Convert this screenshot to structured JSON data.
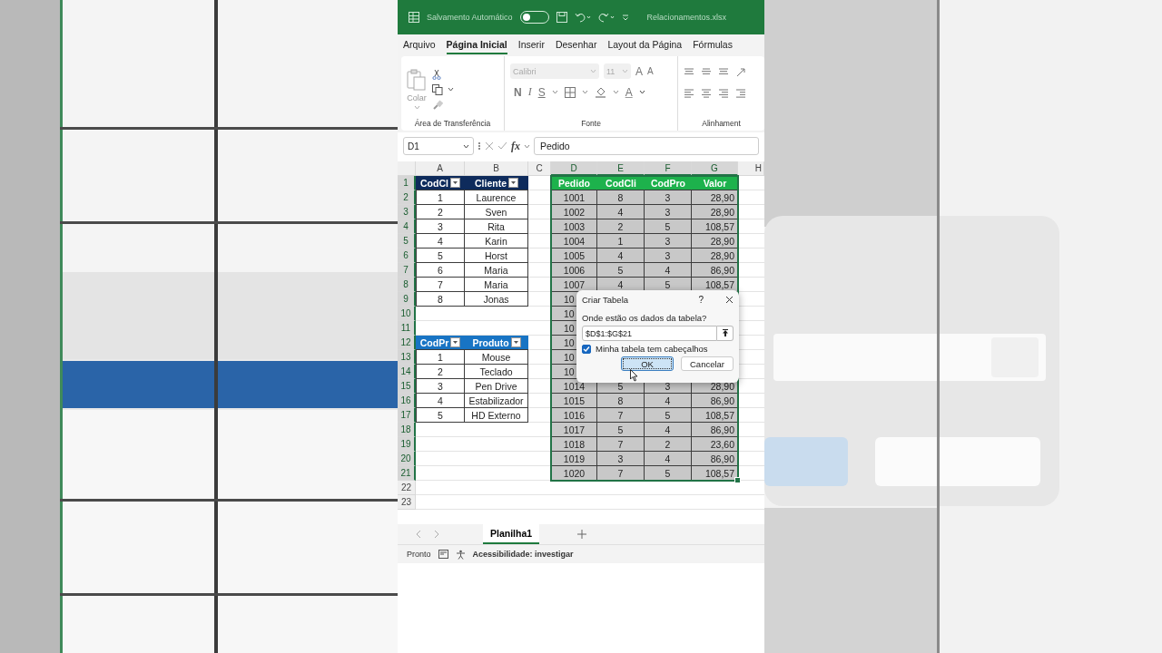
{
  "title_bar": {
    "autosave_label": "Salvamento Automático",
    "autosave_on": false,
    "file_name": "Relacionamentos.xlsx"
  },
  "ribbon_tabs": [
    {
      "label": "Arquivo",
      "selected": false
    },
    {
      "label": "Página Inicial",
      "selected": true
    },
    {
      "label": "Inserir",
      "selected": false
    },
    {
      "label": "Desenhar",
      "selected": false
    },
    {
      "label": "Layout da Página",
      "selected": false
    },
    {
      "label": "Fórmulas",
      "selected": false
    }
  ],
  "ribbon": {
    "paste_label": "Colar",
    "font_name": "Calibri",
    "font_size": "11",
    "font_size_buttons": [
      "A",
      "A"
    ],
    "style_buttons": [
      "N",
      "I",
      "S"
    ],
    "font_color_button": "A",
    "groups": [
      "Área de Transferência",
      "Fonte",
      "Alinhament"
    ]
  },
  "formula_bar": {
    "name_box": "D1",
    "function_label": "fx",
    "formula": "Pedido"
  },
  "grid": {
    "columns": [
      {
        "label": "A",
        "selected": false
      },
      {
        "label": "B",
        "selected": false
      },
      {
        "label": "C",
        "selected": false
      },
      {
        "label": "D",
        "selected": true
      },
      {
        "label": "E",
        "selected": true
      },
      {
        "label": "F",
        "selected": true
      },
      {
        "label": "G",
        "selected": true
      },
      {
        "label": "H",
        "selected": false
      }
    ],
    "row_headers": [
      {
        "label": "1",
        "selected": true
      },
      {
        "label": "2",
        "selected": true
      },
      {
        "label": "3",
        "selected": true
      },
      {
        "label": "4",
        "selected": true
      },
      {
        "label": "5",
        "selected": true
      },
      {
        "label": "6",
        "selected": true
      },
      {
        "label": "7",
        "selected": true
      },
      {
        "label": "8",
        "selected": true
      },
      {
        "label": "9",
        "selected": true
      },
      {
        "label": "10",
        "selected": true
      },
      {
        "label": "11",
        "selected": true
      },
      {
        "label": "12",
        "selected": true
      },
      {
        "label": "13",
        "selected": true
      },
      {
        "label": "14",
        "selected": true
      },
      {
        "label": "15",
        "selected": true
      },
      {
        "label": "16",
        "selected": true
      },
      {
        "label": "17",
        "selected": true
      },
      {
        "label": "18",
        "selected": true
      },
      {
        "label": "19",
        "selected": true
      },
      {
        "label": "20",
        "selected": true
      },
      {
        "label": "21",
        "selected": true
      },
      {
        "label": "22",
        "selected": false
      },
      {
        "label": "23",
        "selected": false
      }
    ]
  },
  "tables": [
    {
      "color": "#0e2b5c",
      "filter_buttons": true,
      "selected": false,
      "columns": [
        {
          "label": "CodCl"
        },
        {
          "label": "Cliente"
        }
      ],
      "rows": [
        {
          "cells": [
            "1",
            "Laurence"
          ]
        },
        {
          "cells": [
            "2",
            "Sven"
          ]
        },
        {
          "cells": [
            "3",
            "Rita"
          ]
        },
        {
          "cells": [
            "4",
            "Karin"
          ]
        },
        {
          "cells": [
            "5",
            "Horst"
          ]
        },
        {
          "cells": [
            "6",
            "Maria"
          ]
        },
        {
          "cells": [
            "7",
            "Maria"
          ]
        },
        {
          "cells": [
            "8",
            "Jonas"
          ]
        }
      ]
    },
    {
      "color": "#1874c4",
      "filter_buttons": true,
      "selected": false,
      "columns": [
        {
          "label": "CodPr"
        },
        {
          "label": "Produto"
        }
      ],
      "rows": [
        {
          "cells": [
            "1",
            "Mouse"
          ]
        },
        {
          "cells": [
            "2",
            "Teclado"
          ]
        },
        {
          "cells": [
            "3",
            "Pen Drive"
          ]
        },
        {
          "cells": [
            "4",
            "Estabilizador"
          ]
        },
        {
          "cells": [
            "5",
            "HD Externo"
          ]
        }
      ]
    },
    {
      "color": "#1db24c",
      "filter_buttons": false,
      "selected": true,
      "columns": [
        {
          "label": "Pedido"
        },
        {
          "label": "CodCli"
        },
        {
          "label": "CodPro"
        },
        {
          "label": "Valor"
        }
      ],
      "rows": [
        {
          "cells": [
            "1001",
            "8",
            "3",
            "28,90"
          ],
          "covered": false
        },
        {
          "cells": [
            "1002",
            "4",
            "3",
            "28,90"
          ],
          "covered": false
        },
        {
          "cells": [
            "1003",
            "2",
            "5",
            "108,57"
          ],
          "covered": false
        },
        {
          "cells": [
            "1004",
            "1",
            "3",
            "28,90"
          ],
          "covered": false
        },
        {
          "cells": [
            "1005",
            "4",
            "3",
            "28,90"
          ],
          "covered": false
        },
        {
          "cells": [
            "1006",
            "5",
            "4",
            "86,90"
          ],
          "covered": false
        },
        {
          "cells": [
            "1007",
            "4",
            "5",
            "108,57"
          ],
          "covered": false
        },
        {
          "cells": [
            "10"
          ],
          "covered": true
        },
        {
          "cells": [
            "10"
          ],
          "covered": true
        },
        {
          "cells": [
            "10"
          ],
          "covered": true
        },
        {
          "cells": [
            "10"
          ],
          "covered": true
        },
        {
          "cells": [
            "10"
          ],
          "covered": true
        },
        {
          "cells": [
            "10"
          ],
          "covered": true
        },
        {
          "cells": [
            "1014",
            "5",
            "3",
            "28,90"
          ],
          "covered": false
        },
        {
          "cells": [
            "1015",
            "8",
            "4",
            "86,90"
          ],
          "covered": false
        },
        {
          "cells": [
            "1016",
            "7",
            "5",
            "108,57"
          ],
          "covered": false
        },
        {
          "cells": [
            "1017",
            "5",
            "4",
            "86,90"
          ],
          "covered": false
        },
        {
          "cells": [
            "1018",
            "7",
            "2",
            "23,60"
          ],
          "covered": false
        },
        {
          "cells": [
            "1019",
            "3",
            "4",
            "86,90"
          ],
          "covered": false
        },
        {
          "cells": [
            "1020",
            "7",
            "5",
            "108,57"
          ],
          "covered": false
        }
      ]
    }
  ],
  "dialog": {
    "title": "Criar Tabela",
    "help": "?",
    "question": "Onde estão os dados da tabela?",
    "range": "$D$1:$G$21",
    "has_headers_label": "Minha tabela tem cabeçalhos",
    "has_headers": true,
    "buttons": [
      {
        "label": "OK",
        "kind": "primary"
      },
      {
        "label": "Cancelar",
        "kind": "secondary"
      }
    ]
  },
  "sheet_tabs": [
    {
      "label": "Planilha1",
      "selected": true
    }
  ],
  "status_bar": {
    "mode": "Pronto",
    "accessibility": "Acessibilidade: investigar"
  }
}
